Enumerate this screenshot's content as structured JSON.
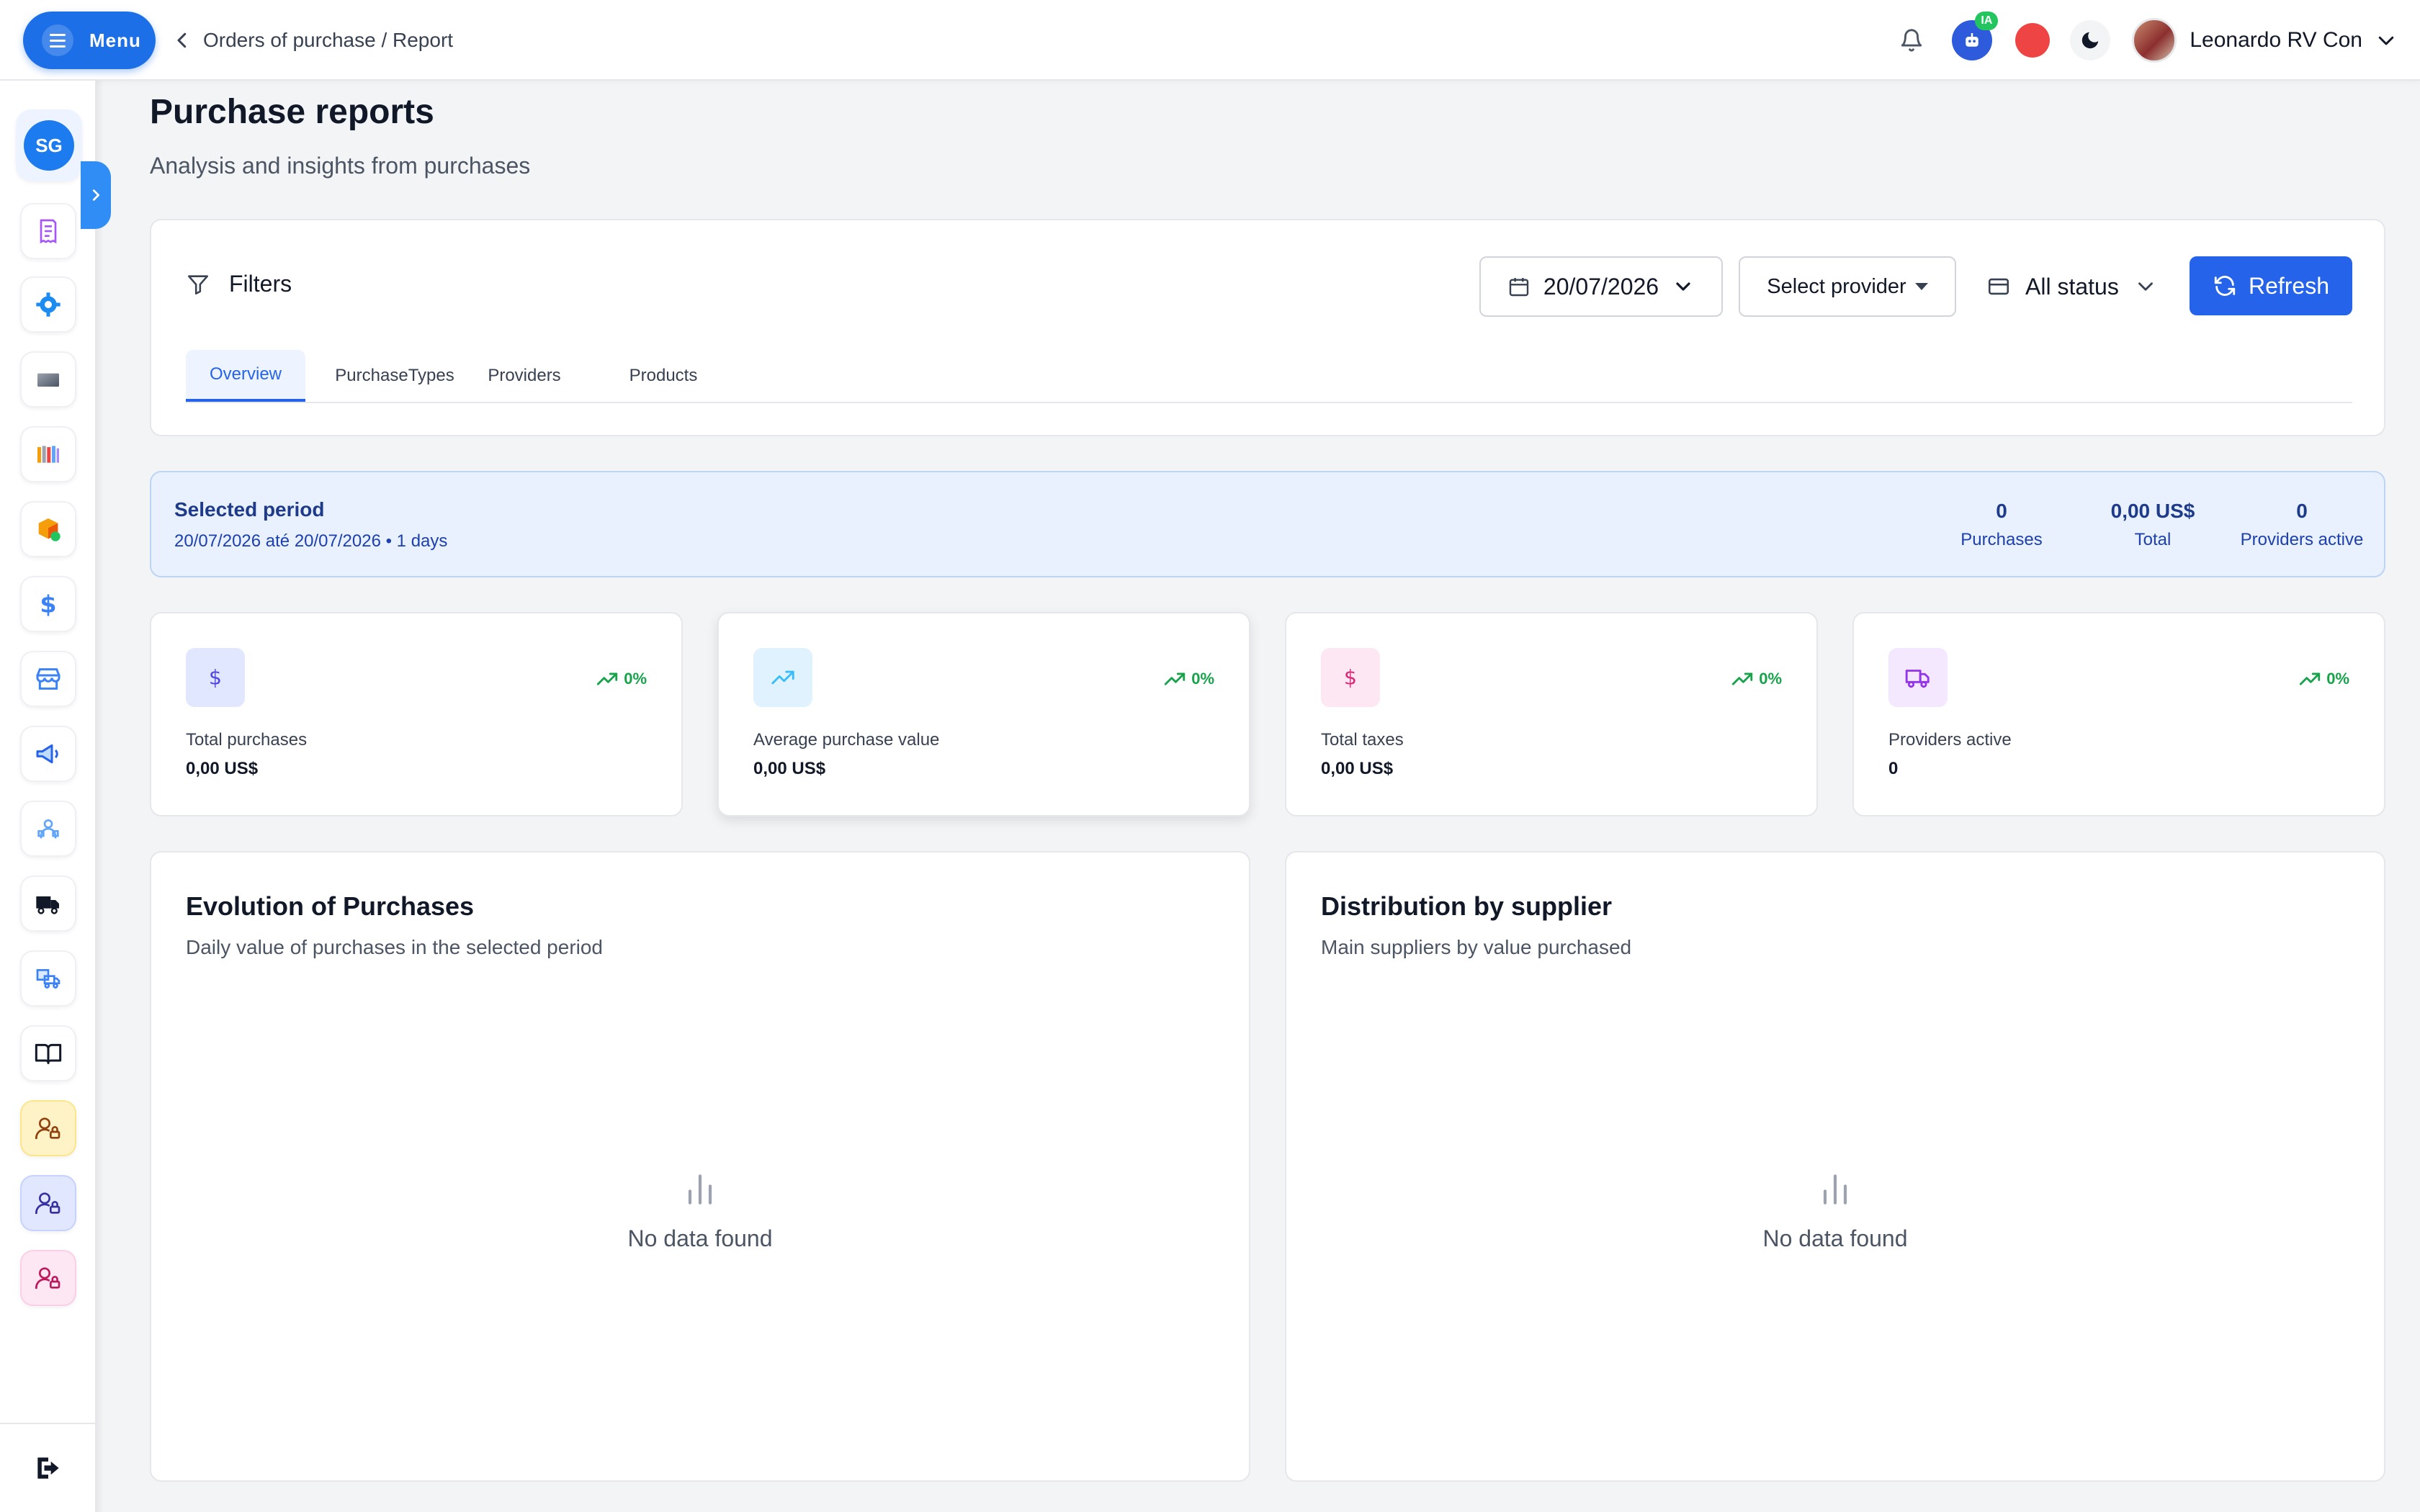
{
  "header": {
    "menu_label": "Menu",
    "breadcrumb": "Orders of purchase / Report",
    "ia_badge": "IA",
    "user_name": "Leonardo RV Con"
  },
  "sidebar": {
    "badge_initials": "SG",
    "items": [
      {
        "icon": "receipt-icon"
      },
      {
        "icon": "gear-icon"
      },
      {
        "icon": "card-icon"
      },
      {
        "icon": "books-icon"
      },
      {
        "icon": "package-icon"
      },
      {
        "icon": "dollar-icon"
      },
      {
        "icon": "store-icon"
      },
      {
        "icon": "megaphone-icon"
      },
      {
        "icon": "team-icon"
      },
      {
        "icon": "truck-icon"
      },
      {
        "icon": "delivery-icon"
      },
      {
        "icon": "book-icon"
      },
      {
        "icon": "user-lock-icon"
      },
      {
        "icon": "user-lock-icon"
      },
      {
        "icon": "user-lock-icon"
      }
    ]
  },
  "page": {
    "title": "Purchase reports",
    "subtitle": "Analysis and insights from purchases"
  },
  "filters": {
    "label": "Filters",
    "date": "20/07/2026",
    "provider_placeholder": "Select provider",
    "status": "All status",
    "refresh_label": "Refresh",
    "tabs": [
      {
        "label": "Overview",
        "active": true
      },
      {
        "label": "PurchaseTypes",
        "active": false
      },
      {
        "label": "Providers",
        "active": false
      },
      {
        "label": "Products",
        "active": false
      }
    ]
  },
  "period": {
    "title": "Selected period",
    "range": "20/07/2026 até 20/07/2026 • 1 days",
    "stats": [
      {
        "value": "0",
        "label": "Purchases"
      },
      {
        "value": "0,00 US$",
        "label": "Total"
      },
      {
        "value": "0",
        "label": "Providers active"
      }
    ]
  },
  "kpis": [
    {
      "label": "Total purchases",
      "value": "0,00 US$",
      "trend": "0%",
      "icon": "dollar-icon",
      "icon_color": "#4f46e5",
      "icon_bg": "#e0e7ff"
    },
    {
      "label": "Average purchase value",
      "value": "0,00 US$",
      "trend": "0%",
      "icon": "trend-up-icon",
      "icon_color": "#38bdf8",
      "icon_bg": "#e0f2fe"
    },
    {
      "label": "Total taxes",
      "value": "0,00 US$",
      "trend": "0%",
      "icon": "dollar-icon",
      "icon_color": "#db2777",
      "icon_bg": "#fce7f3"
    },
    {
      "label": "Providers active",
      "value": "0",
      "trend": "0%",
      "icon": "truck-icon",
      "icon_color": "#9333ea",
      "icon_bg": "#f3e8ff"
    }
  ],
  "charts": [
    {
      "title": "Evolution of Purchases",
      "subtitle": "Daily value of purchases in the selected period",
      "empty_text": "No data found"
    },
    {
      "title": "Distribution by supplier",
      "subtitle": "Main suppliers by value purchased",
      "empty_text": "No data found"
    }
  ],
  "colors": {
    "primary": "#2563eb",
    "trend_positive": "#16a34a",
    "period_bg": "#e8f1fd"
  }
}
